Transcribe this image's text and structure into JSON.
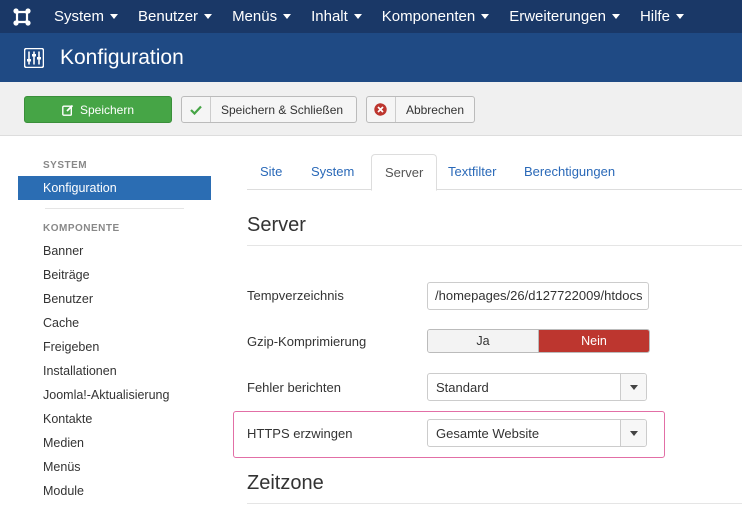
{
  "nav": {
    "items": [
      {
        "label": "System"
      },
      {
        "label": "Benutzer"
      },
      {
        "label": "Menüs"
      },
      {
        "label": "Inhalt"
      },
      {
        "label": "Komponenten"
      },
      {
        "label": "Erweiterungen"
      },
      {
        "label": "Hilfe"
      }
    ]
  },
  "header": {
    "title": "Konfiguration"
  },
  "toolbar": {
    "save_label": "Speichern",
    "save_close_label": "Speichern & Schließen",
    "cancel_label": "Abbrechen"
  },
  "sidebar": {
    "system_heading": "SYSTEM",
    "system_item": "Konfiguration",
    "components_heading": "KOMPONENTE",
    "components": [
      "Banner",
      "Beiträge",
      "Benutzer",
      "Cache",
      "Freigeben",
      "Installationen",
      "Joomla!-Aktualisierung",
      "Kontakte",
      "Medien",
      "Menüs",
      "Module"
    ]
  },
  "tabs": [
    "Site",
    "System",
    "Server",
    "Textfilter",
    "Berechtigungen"
  ],
  "active_tab": "Server",
  "server": {
    "title": "Server",
    "temp_label": "Tempverzeichnis",
    "temp_value": "/homepages/26/d127722009/htdocs",
    "gzip_label": "Gzip-Komprimierung",
    "gzip_yes": "Ja",
    "gzip_no": "Nein",
    "error_label": "Fehler berichten",
    "error_value": "Standard",
    "https_label": "HTTPS erzwingen",
    "https_value": "Gesamte Website"
  },
  "timezone": {
    "title": "Zeitzone"
  },
  "colors": {
    "nav_bg": "#1a3867",
    "header_bg": "#1f4a84",
    "save_green": "#46a546",
    "active_blue": "#2b6db3",
    "nein_red": "#bd362f",
    "highlight_pink": "#e26fa6"
  }
}
